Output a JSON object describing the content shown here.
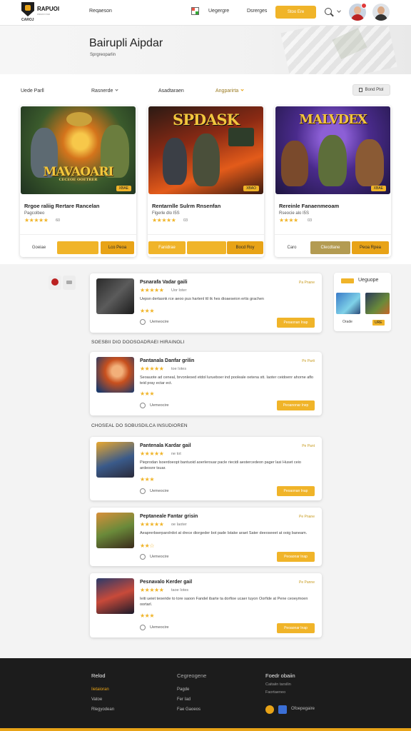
{
  "header": {
    "brand": "RAPUOI",
    "brand_sub": "PRMXXYXIM",
    "brand_mini": "CAROJ",
    "nav_browse": "Reqaeson",
    "nav_upgrade": "Uegergre",
    "nav_designs": "Dsrerges",
    "cta_label": "Stoo Ere"
  },
  "hero": {
    "title": "Bairupli Aipdar",
    "subtitle": "Sprgreoparlin"
  },
  "filters": {
    "label_main": "Uede Parll",
    "option_1": "Rasnerde",
    "option_2": "Asadtaraen",
    "option_3": "Angparirta",
    "sort_label": "Bond Ptol"
  },
  "featured": [
    {
      "art_text": "MAVAOARI",
      "art_sub": "CECEOE OOETRER",
      "chip": "XBAE",
      "title": "Rrgoe raliig Rertare Rancelan",
      "meta": "Pagcolbeo",
      "rating_stars": "★★★★★",
      "rating_count": "60",
      "btn_left": "Goeiae",
      "btn_mid": "",
      "btn_right": "Lco Peoa"
    },
    {
      "art_text": "SPDASK",
      "art_sub": "",
      "chip": "XBAO",
      "title": "Rentarnlle Sulrm Rnsenfan",
      "meta": "Flgerle dlo  I5S",
      "rating_stars": "★★★★★",
      "rating_count": "03",
      "btn_left": "Fanidrae",
      "btn_mid": "",
      "btn_right": "Bocd Roy"
    },
    {
      "art_text": "MALVDEX",
      "art_sub": "",
      "chip": "XBAE",
      "title": "Rereinle Fanaenmeoam",
      "meta": "Rseocie alo  I5S",
      "rating_stars": "★★★★",
      "rating_count": "03",
      "btn_left": "Caro",
      "btn_mid": "Clecdtane",
      "btn_right": "Peoa Rpea"
    }
  ],
  "sidebar_right": {
    "label": "Ueguope",
    "cap_1": "Orade",
    "cap_2": "URE"
  },
  "sections": {
    "section_1": "SOESBII DIO DOOSOADRAEI HIRAINOLI",
    "section_2": "CHOSEAL DO SOBUSDILCA INSUDIOREN"
  },
  "list": [
    {
      "title": "Psnarafa Vadar gaili",
      "tag": "Pa Pnane",
      "stars": "★★★★★",
      "count": "Uor Ioter",
      "desc": "Uepsn dertasnk rce aeoo pus hartenl ttI tk hes dioaeseion ertis grachen",
      "stars_sm": "★★★",
      "status": "Uemeocire",
      "cta": "Peoaonan Inap"
    },
    {
      "title": "Pantanala Danfar grilin",
      "tag": "Po Parti",
      "stars": "★★★★★",
      "count": "toe Iotes",
      "desc": "Seoauote ad ceneal, brvonleoed etdol lurueboer ind pooleale oetena stt. Iaoter ceidoenr ahorne aflo teid pray ectar ect.",
      "stars_sm": "★★★",
      "status": "Uemeocire",
      "cta": "Peoanonar Inep"
    },
    {
      "title": "Pantenala Kardar gail",
      "tag": "Pe Pant",
      "stars": "★★★★★",
      "count": "ne tot",
      "desc": "Pieprodan lsoerdoeopt bantuoid aoerlerouar pacle riecidi aestercedeon pager lasi Huset ceio ardeosnr tsuar.",
      "stars_sm": "★★★",
      "status": "Uemeocire",
      "cta": "Peoaonan Inap"
    },
    {
      "title": "Peptaneale Fantar grisin",
      "tag": "Pe Pnane",
      "stars": "★★★★★",
      "count": "oe Iaoter",
      "desc": "Aeaprerbserparolrdot at drece diorgeder bot pade Istake araet Sater deeoseeet at ooig baneam.",
      "stars_sm": "★★☆",
      "status": "Uemeocire",
      "cta": "Peoaonar Inap"
    },
    {
      "title": "Pesnavalo Kerder gail",
      "tag": "Pe Panne",
      "stars": "★★★★★",
      "count": "taoe Iotes",
      "desc": "Ieiti ueiet teoeride to tore saoon Fandel ibarte ta dorfioe ucaer tuyon Oorfide at Pene ceoeymoen oortarl.",
      "stars_sm": "★★★",
      "status": "Uemeocire",
      "cta": "Peoaonar Inap"
    }
  ],
  "footer": {
    "col1_head": "Relod",
    "col1_links": [
      "Iietaioran",
      "Vatoe",
      "Rlegyodean"
    ],
    "col2_head": "Cegreogene",
    "col2_links": [
      "Pagde",
      "Fer Iad",
      "Fae Gaoeos"
    ],
    "col3_head": "Foedr obaiin",
    "col3_sub_1": "Caitaiin tarsilin",
    "col3_sub_2": "Faortaeneo",
    "social_label": "Ofoepegaire"
  },
  "colors": {
    "accent": "#f0b429",
    "accent_dark": "#e8a317",
    "footer_bg": "#1c1c1c"
  },
  "icons": [
    "search-icon",
    "chevron-down-icon",
    "grid-icon",
    "sort-icon",
    "radio-icon",
    "instagram-icon",
    "facebook-icon"
  ]
}
